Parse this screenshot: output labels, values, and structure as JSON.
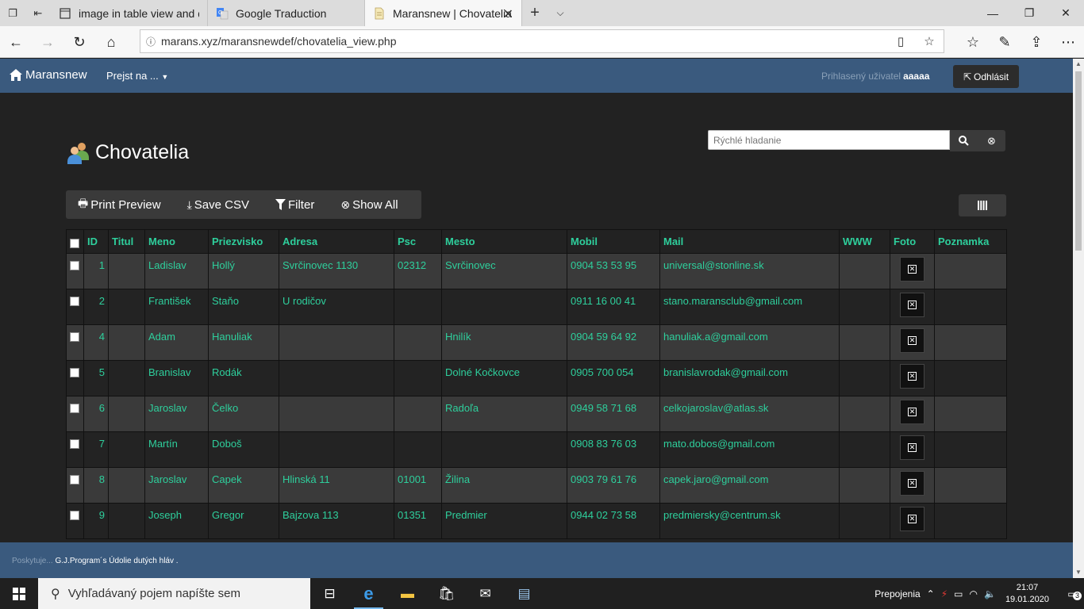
{
  "browser": {
    "tabs": [
      {
        "title": "image in table view and det",
        "icon": "page-icon",
        "active": false
      },
      {
        "title": "Google Traduction",
        "icon": "google-translate-icon",
        "active": false
      },
      {
        "title": "Maransnew | Chovatelia",
        "icon": "document-icon",
        "active": true
      }
    ],
    "url": "marans.xyz/maransnewdef/chovatelia_view.php"
  },
  "app": {
    "brand": "Maransnew",
    "goto_menu": "Prejst na ...",
    "user_label": "Prihlasený uživatel",
    "username": "aaaaa",
    "logout_label": "Odhlásit"
  },
  "page": {
    "title": "Chovatelia",
    "search_placeholder": "Rýchlé hladanie"
  },
  "toolbar": {
    "print_preview": "Print Preview",
    "save_csv": "Save CSV",
    "filter": "Filter",
    "show_all": "Show All"
  },
  "table": {
    "columns": [
      "ID",
      "Titul",
      "Meno",
      "Priezvisko",
      "Adresa",
      "Psc",
      "Mesto",
      "Mobil",
      "Mail",
      "WWW",
      "Foto",
      "Poznamka"
    ],
    "rows": [
      {
        "id": "1",
        "titul": "",
        "meno": "Ladislav",
        "priezvisko": "Hollý",
        "adresa": "Svrčinovec 1130",
        "psc": "02312",
        "mesto": "Svrčinovec",
        "mobil": "0904 53 53 95",
        "mail": "universal@stonline.sk",
        "www": "",
        "poznamka": ""
      },
      {
        "id": "2",
        "titul": "",
        "meno": "František",
        "priezvisko": "Staňo",
        "adresa": "U rodičov",
        "psc": "",
        "mesto": "",
        "mobil": "0911 16 00 41",
        "mail": "stano.maransclub@gmail.com",
        "www": "",
        "poznamka": ""
      },
      {
        "id": "4",
        "titul": "",
        "meno": "Adam",
        "priezvisko": "Hanuliak",
        "adresa": "",
        "psc": "",
        "mesto": "Hnilík",
        "mobil": "0904 59 64 92",
        "mail": "hanuliak.a@gmail.com",
        "www": "",
        "poznamka": ""
      },
      {
        "id": "5",
        "titul": "",
        "meno": "Branislav",
        "priezvisko": "Rodák",
        "adresa": "",
        "psc": "",
        "mesto": "Dolné Kočkovce",
        "mobil": "0905 700 054",
        "mail": "branislavrodak@gmail.com",
        "www": "",
        "poznamka": ""
      },
      {
        "id": "6",
        "titul": "",
        "meno": "Jaroslav",
        "priezvisko": "Čelko",
        "adresa": "",
        "psc": "",
        "mesto": "Radoľa",
        "mobil": "0949 58 71 68",
        "mail": "celkojaroslav@atlas.sk",
        "www": "",
        "poznamka": ""
      },
      {
        "id": "7",
        "titul": "",
        "meno": "Martín",
        "priezvisko": "Doboš",
        "adresa": "",
        "psc": "",
        "mesto": "",
        "mobil": "0908 83 76 03",
        "mail": "mato.dobos@gmail.com",
        "www": "",
        "poznamka": ""
      },
      {
        "id": "8",
        "titul": "",
        "meno": "Jaroslav",
        "priezvisko": "Capek",
        "adresa": "Hlinská 11",
        "psc": "01001",
        "mesto": "Žilina",
        "mobil": "0903 79 61 76",
        "mail": "capek.jaro@gmail.com",
        "www": "",
        "poznamka": ""
      },
      {
        "id": "9",
        "titul": "",
        "meno": "Joseph",
        "priezvisko": "Gregor",
        "adresa": "Bajzova 113",
        "psc": "01351",
        "mesto": "Predmier",
        "mobil": "0944 02 73 58",
        "mail": "predmiersky@centrum.sk",
        "www": "",
        "poznamka": ""
      }
    ]
  },
  "footer": {
    "prefix": "Poskytuje...",
    "text": "G.J.Program´s Údolie dutých hláv ."
  },
  "taskbar": {
    "search_placeholder": "Vyhľadávaný pojem napíšte sem",
    "tray_label": "Prepojenia",
    "time": "21:07",
    "date": "19.01.2020",
    "notification_count": "3"
  },
  "colors": {
    "navbar": "#3a5a7e",
    "accent_text": "#2ecf9c",
    "row_odd": "#3a3a3a",
    "row_even": "#232323"
  }
}
